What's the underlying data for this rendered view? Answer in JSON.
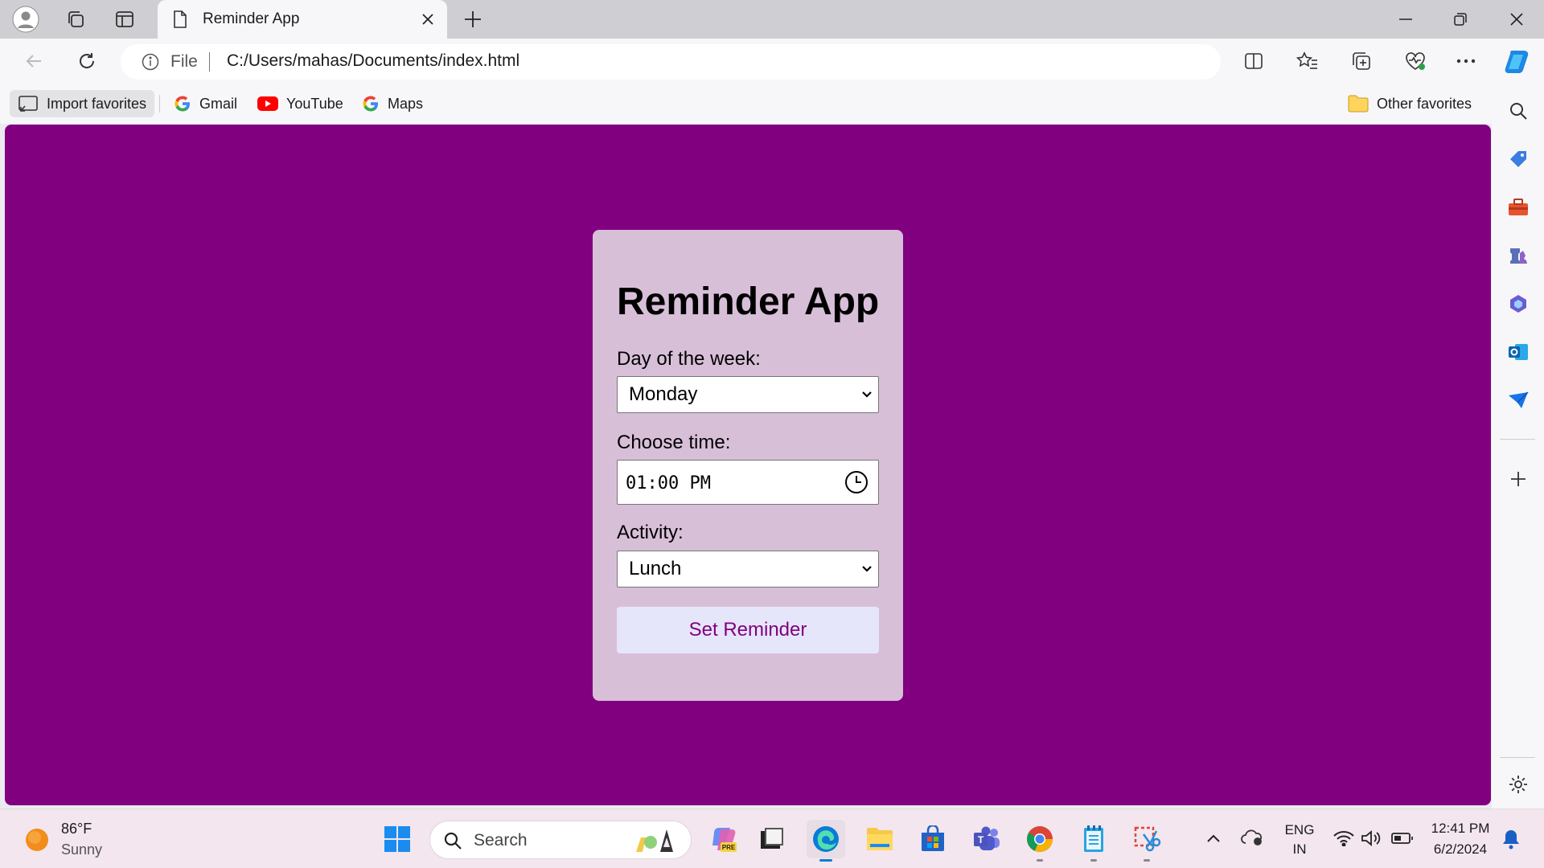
{
  "browser": {
    "tab_title": "Reminder App",
    "address": {
      "scheme_label": "File",
      "url": "C:/Users/mahas/Documents/index.html"
    },
    "favorites": [
      {
        "label": "Import favorites",
        "icon": "import-icon"
      },
      {
        "label": "Gmail",
        "icon": "google-icon"
      },
      {
        "label": "YouTube",
        "icon": "youtube-icon"
      },
      {
        "label": "Maps",
        "icon": "google-icon"
      }
    ],
    "other_favorites_label": "Other favorites"
  },
  "app": {
    "title": "Reminder App",
    "day_label": "Day of the week:",
    "day_value": "Monday",
    "time_label": "Choose time:",
    "time_value": "01:00 PM",
    "activity_label": "Activity:",
    "activity_value": "Lunch",
    "submit_label": "Set Reminder",
    "colors": {
      "page_bg": "#800080",
      "card_bg": "#d8bfd8",
      "button_bg": "#e6e6fa",
      "button_text": "#800080"
    }
  },
  "taskbar": {
    "weather_temp": "86°F",
    "weather_desc": "Sunny",
    "search_placeholder": "Search",
    "language_line1": "ENG",
    "language_line2": "IN",
    "clock_time": "12:41 PM",
    "clock_date": "6/2/2024"
  }
}
